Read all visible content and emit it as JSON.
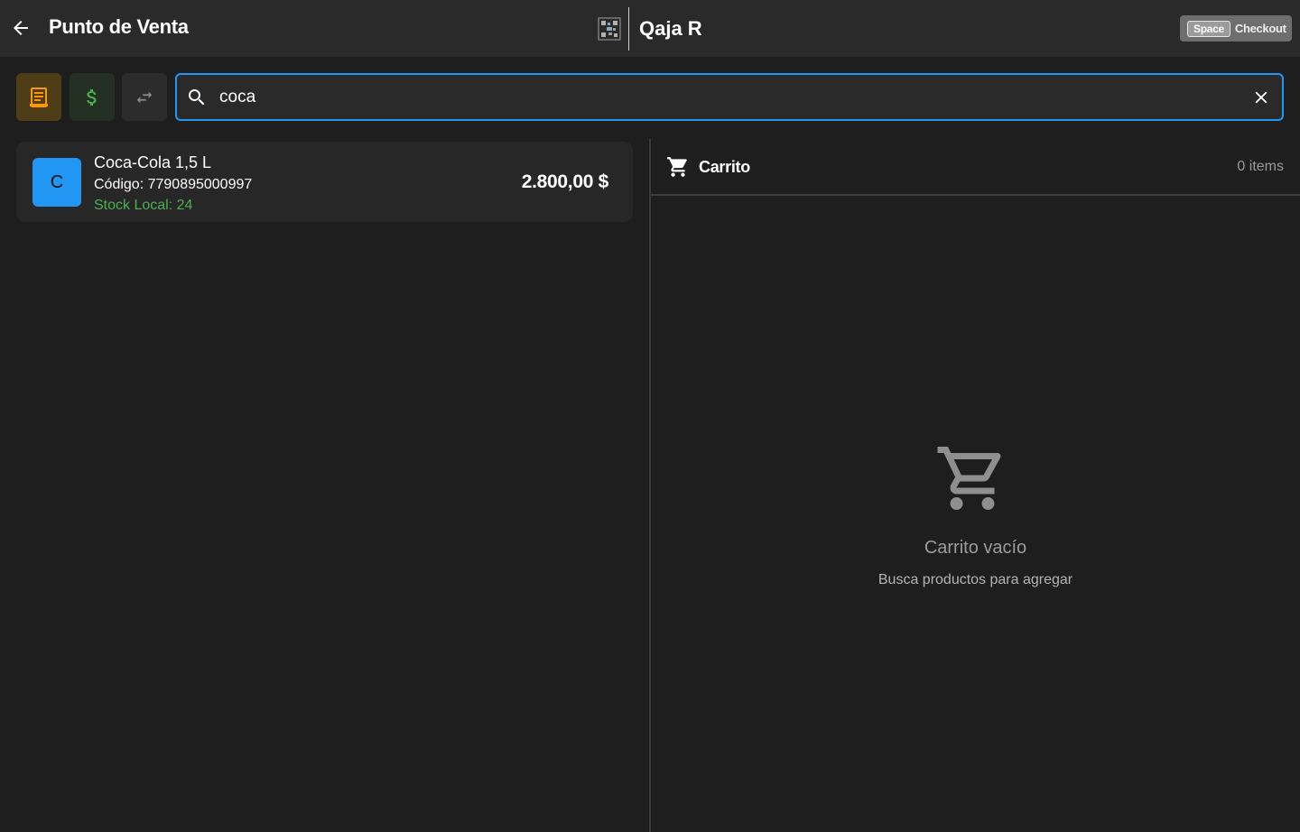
{
  "appbar": {
    "title": "Punto de Venta",
    "brand_name": "Qaja R",
    "checkout": {
      "key": "Space",
      "label": "Checkout"
    }
  },
  "toolbar": {
    "buttons": [
      {
        "icon": "receipt-icon",
        "color": "#ff9800"
      },
      {
        "icon": "dollar-icon",
        "color": "#4caf50"
      },
      {
        "icon": "swap-icon",
        "color": "#8a8a8a"
      }
    ]
  },
  "search": {
    "value": "coca",
    "placeholder": ""
  },
  "results": [
    {
      "initial": "C",
      "name": "Coca-Cola 1,5 L",
      "code": "Código: 7790895000997",
      "stock": "Stock Local: 24",
      "price": "2.800,00 $"
    }
  ],
  "cart": {
    "title": "Carrito",
    "count": "0 items",
    "empty_title": "Carrito vacío",
    "empty_subtitle": "Busca productos para agregar"
  },
  "colors": {
    "accent": "#2196f3",
    "stock_ok": "#4caf50",
    "background": "#1e1e1e",
    "appbar": "#2a2a2a"
  }
}
